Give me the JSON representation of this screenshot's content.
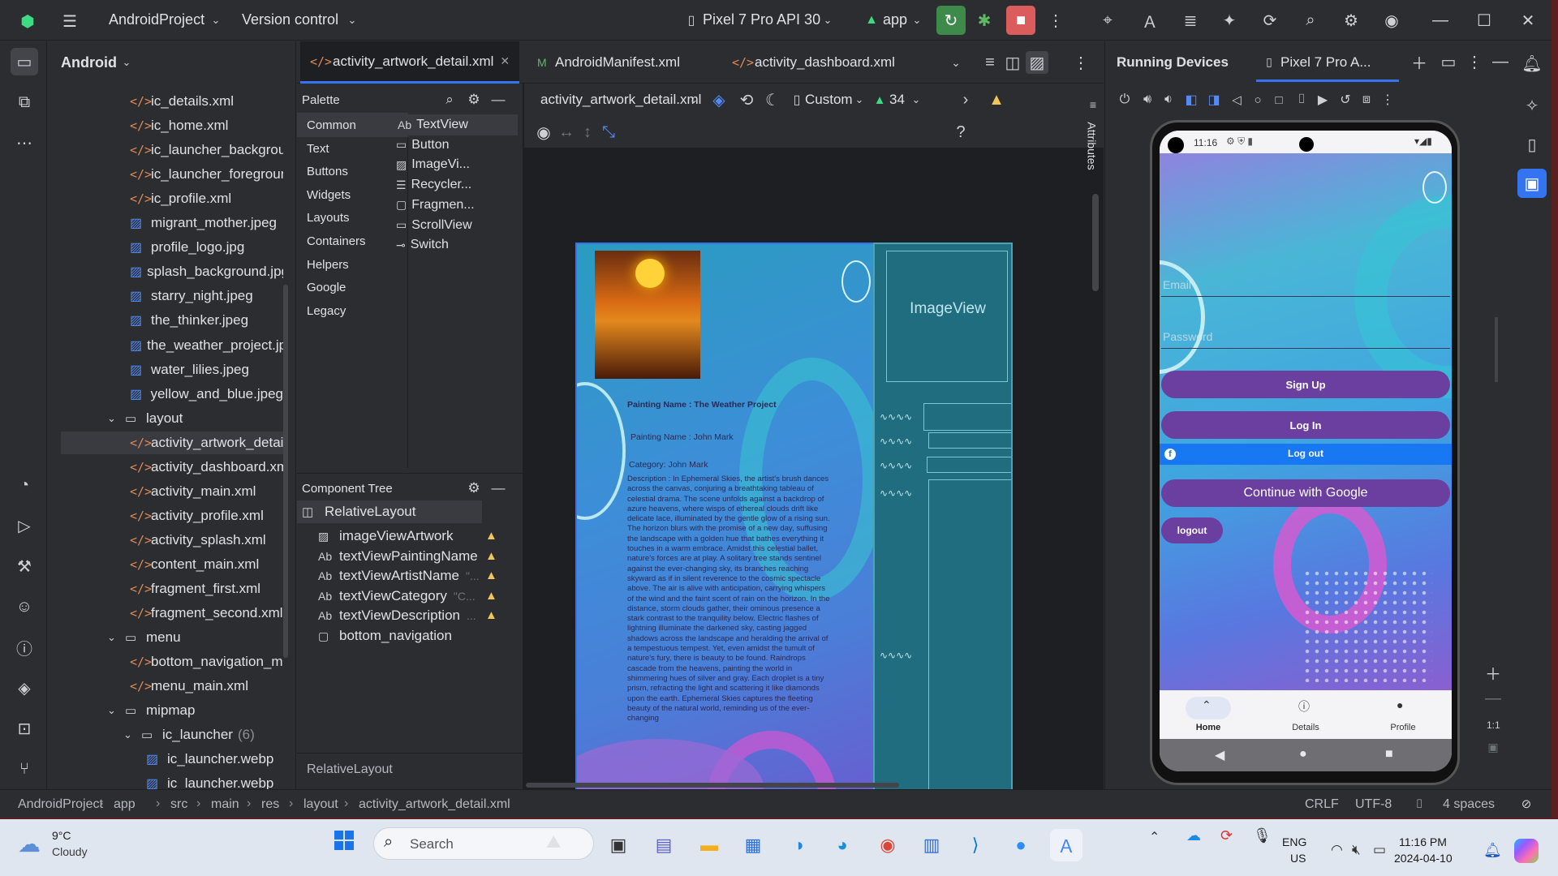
{
  "titlebar": {
    "project": "AndroidProject",
    "vcs": "Version control",
    "device": "Pixel 7 Pro API 30",
    "config": "app"
  },
  "project_panel": {
    "view": "Android",
    "rows": [
      {
        "label": "ic_details.xml",
        "type": "xml"
      },
      {
        "label": "ic_home.xml",
        "type": "xml"
      },
      {
        "label": "ic_launcher_background.xml",
        "type": "xml"
      },
      {
        "label": "ic_launcher_foreground.xml",
        "type": "xml"
      },
      {
        "label": "ic_profile.xml",
        "type": "xml"
      },
      {
        "label": "migrant_mother.jpeg",
        "type": "img"
      },
      {
        "label": "profile_logo.jpg",
        "type": "img"
      },
      {
        "label": "splash_background.jpg",
        "type": "img"
      },
      {
        "label": "starry_night.jpeg",
        "type": "img"
      },
      {
        "label": "the_thinker.jpeg",
        "type": "img"
      },
      {
        "label": "the_weather_project.jpg",
        "type": "img"
      },
      {
        "label": "water_lilies.jpeg",
        "type": "img"
      },
      {
        "label": "yellow_and_blue.jpeg",
        "type": "img"
      },
      {
        "label": "layout",
        "type": "folder"
      },
      {
        "label": "activity_artwork_detail.xml",
        "type": "xml"
      },
      {
        "label": "activity_dashboard.xml",
        "type": "xml"
      },
      {
        "label": "activity_main.xml",
        "type": "xml"
      },
      {
        "label": "activity_profile.xml",
        "type": "xml"
      },
      {
        "label": "activity_splash.xml",
        "type": "xml"
      },
      {
        "label": "content_main.xml",
        "type": "xml"
      },
      {
        "label": "fragment_first.xml",
        "type": "xml"
      },
      {
        "label": "fragment_second.xml",
        "type": "xml"
      },
      {
        "label": "menu",
        "type": "folder"
      },
      {
        "label": "bottom_navigation_menu.xml",
        "type": "xml"
      },
      {
        "label": "menu_main.xml",
        "type": "xml"
      },
      {
        "label": "mipmap",
        "type": "folder"
      },
      {
        "label": "ic_launcher",
        "type": "folder",
        "count": "(6)"
      },
      {
        "label": "ic_launcher.webp",
        "type": "img"
      },
      {
        "label": "ic_launcher.webp",
        "type": "img"
      }
    ]
  },
  "editor_tabs": [
    "activity_artwork_detail.xml",
    "AndroidManifest.xml",
    "activity_dashboard.xml"
  ],
  "palette": {
    "title": "Palette",
    "categories": [
      "Common",
      "Text",
      "Buttons",
      "Widgets",
      "Layouts",
      "Containers",
      "Helpers",
      "Google",
      "Legacy"
    ],
    "items": [
      "TextView",
      "Button",
      "ImageVi...",
      "Recycler...",
      "Fragmen...",
      "ScrollView",
      "Switch"
    ]
  },
  "design_toolbar": {
    "file": "activity_artwork_detail.xml",
    "device": "Custom",
    "api": "34"
  },
  "component_tree": {
    "title": "Component Tree",
    "root": "RelativeLayout",
    "children": [
      {
        "icon": "img",
        "label": "imageViewArtwork"
      },
      {
        "icon": "Ab",
        "label": "textViewPaintingName"
      },
      {
        "icon": "Ab",
        "label": "textViewArtistName"
      },
      {
        "icon": "Ab",
        "label": "textViewCategory"
      },
      {
        "icon": "Ab",
        "label": "textViewDescription"
      },
      {
        "icon": "box",
        "label": "bottom_navigation"
      }
    ],
    "hint_artist": "\"...",
    "hint_category": "\"C...",
    "hint_desc": "..."
  },
  "breadcrumb_bottom": "RelativeLayout",
  "preview": {
    "painting_name": "Painting Name : The Weather Project",
    "artist": "Painting Name : John Mark",
    "category": "Category: John Mark",
    "description": "Description : In Ephemeral Skies, the artist's brush dances across the canvas, conjuring a breathtaking tableau of celestial drama. The scene unfolds against a backdrop of azure heavens, where wisps of ethereal clouds drift like delicate lace, illuminated by the gentle glow of a rising sun. The horizon blurs with the promise of a new day, suffusing the landscape with a golden hue that bathes everything it touches in a warm embrace.    Amidst this celestial ballet, nature's forces are at play. A solitary tree stands sentinel against the ever-changing sky, its branches reaching skyward as if in silent reverence to the cosmic spectacle above. The air is alive with anticipation, carrying whispers of the wind and the faint scent of rain on the horizon.    In the distance, storm clouds gather, their ominous presence a stark contrast to the tranquility below. Electric flashes of lightning illuminate the darkened sky, casting jagged shadows across the landscape and heralding the arrival of a tempestuous tempest.    Yet, even amidst the tumult of nature's fury, there is beauty to be found. Raindrops cascade from the heavens, painting the world in shimmering hues of silver and gray. Each droplet is a tiny prism, refracting the light and scattering it like diamonds upon the earth.  Ephemeral Skies captures the fleeting beauty of the natural world, reminding us of the ever-changing",
    "blueprint_label": "ImageView"
  },
  "devices": {
    "title": "Running Devices",
    "tab": "Pixel 7 Pro A...",
    "phone": {
      "time": "11:16",
      "email_placeholder": "Email",
      "password_placeholder": "Password",
      "signup": "Sign Up",
      "login": "Log In",
      "logout_fb": "Log out",
      "google": "Continue with Google",
      "logout": "logout",
      "nav": [
        "Home",
        "Details",
        "Profile"
      ]
    },
    "zoom_label": "1:1"
  },
  "right_rail_label": "Attributes",
  "statusbar": {
    "path": [
      "AndroidProject",
      "app",
      "src",
      "main",
      "res",
      "layout",
      "activity_artwork_detail.xml"
    ],
    "crlf": "CRLF",
    "encoding": "UTF-8",
    "indent": "4 spaces"
  },
  "taskbar": {
    "weather_temp": "9°C",
    "weather_desc": "Cloudy",
    "search": "Search",
    "lang1": "ENG",
    "lang2": "US",
    "time": "11:16 PM",
    "date": "2024-04-10"
  },
  "colors": {
    "accent": "#3574f0",
    "warning": "#f2c55c",
    "run_green": "#3e8a4b",
    "stop_red": "#db5c5c"
  }
}
